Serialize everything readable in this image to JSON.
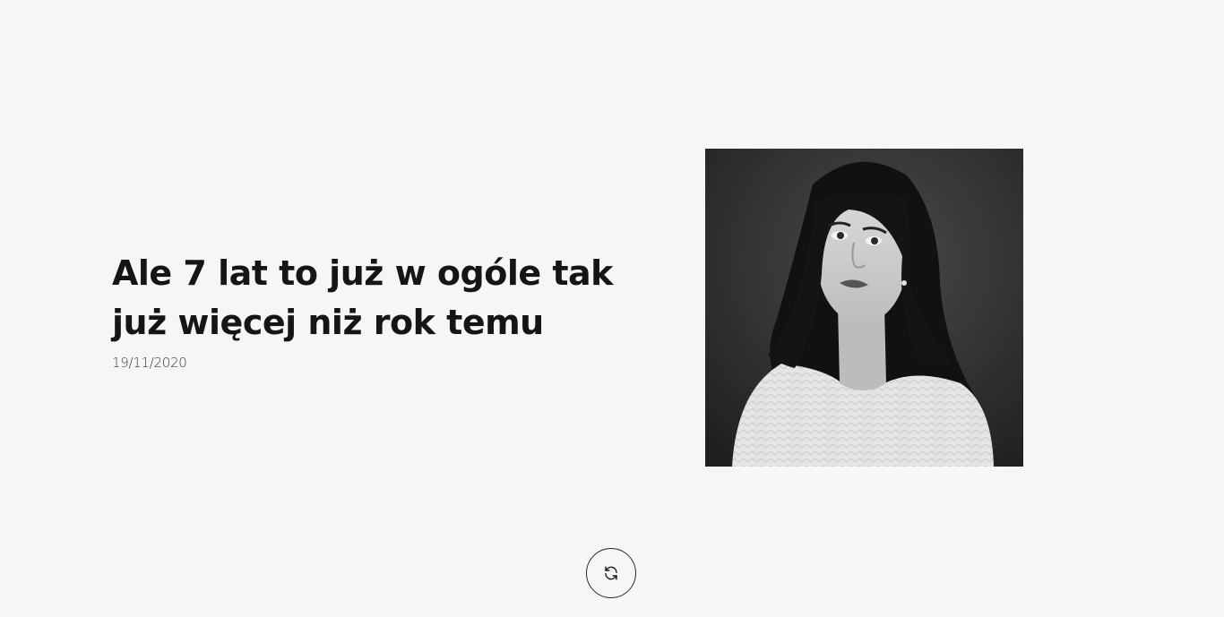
{
  "post": {
    "title": "Ale 7 lat to już w ogóle tak już więcej niż rok temu",
    "date": "19/11/2020"
  },
  "photo": {
    "style": "black-and-white portrait"
  },
  "reload": {
    "icon": "refresh-icon"
  },
  "colors": {
    "background": "#f6f6f6",
    "text": "#151515"
  }
}
